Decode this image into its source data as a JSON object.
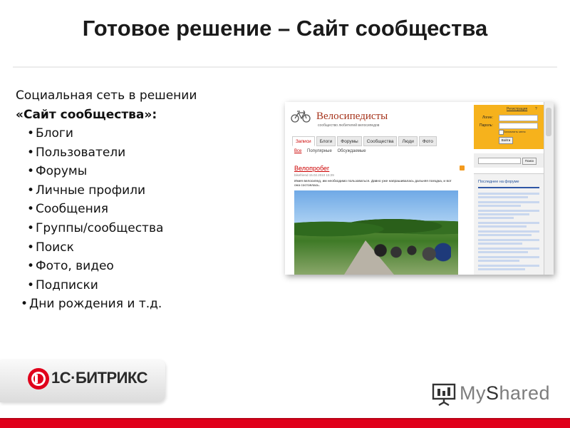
{
  "slide": {
    "title": "Готовое решение – Сайт сообщества",
    "intro_line1": "Социальная сеть в решении",
    "intro_line2": "«Сайт сообщества»:",
    "bullets": [
      "Блоги",
      "Пользователи",
      "Форумы",
      "Личные профили",
      "Сообщения",
      "Группы/сообщества",
      "Поиск",
      "Фото, видео",
      "Подписки",
      "Дни рождения и т.д."
    ]
  },
  "screenshot": {
    "site_title": "Велосипедисты",
    "site_subtitle": "сообщество любителей велосипедов",
    "tabs": [
      "Записи",
      "Блоги",
      "Форумы",
      "Сообщества",
      "Люди",
      "Фото"
    ],
    "subtabs": [
      "Все",
      "Популярные",
      "Обсуждаемые"
    ],
    "post_title": "Велопробег",
    "post_meta": "bikefriend  15.02.2010 15:29",
    "post_text": "Имея велосипед, им необходимо пользоваться. Давно уже напрашивалась дальняя поездка, и вот она состоялась.",
    "login": {
      "register": "Регистрация",
      "help": "?",
      "login_label": "Логин:",
      "password_label": "Пароль:",
      "remember": "Запомнить меня",
      "submit": "Войти"
    },
    "search_button": "Поиск",
    "forum_heading": "Последнее на форуме"
  },
  "footer": {
    "bitrix_text": "1С·БИТРИКС",
    "myshared_my": "My",
    "myshared_s": "S",
    "myshared_rest": "hared",
    "accent_red": "#e0001b"
  }
}
